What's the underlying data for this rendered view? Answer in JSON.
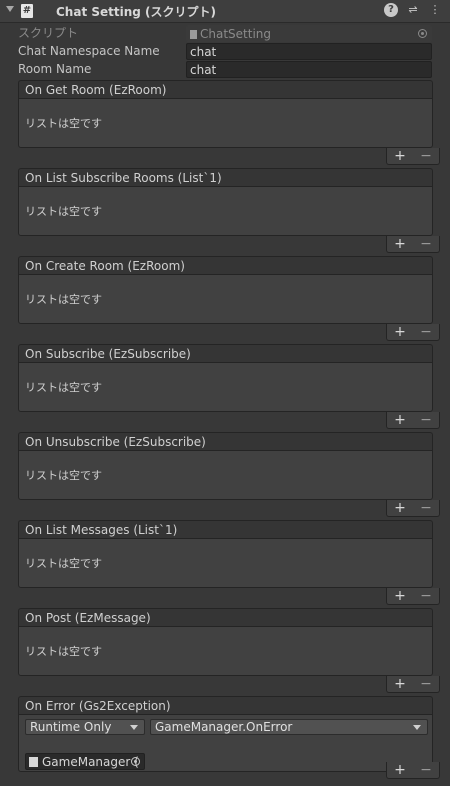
{
  "header": {
    "title": "Chat Setting (スクリプト)",
    "icon": "#"
  },
  "script_row": {
    "label": "スクリプト",
    "value": "ChatSetting"
  },
  "fields": [
    {
      "label": "Chat Namespace Name",
      "value": "chat"
    },
    {
      "label": "Room Name",
      "value": "chat"
    }
  ],
  "events": [
    {
      "title": "On Get Room (EzRoom)",
      "empty_text": "リストは空です"
    },
    {
      "title": "On List Subscribe Rooms (List`1)",
      "empty_text": "リストは空です"
    },
    {
      "title": "On Create Room (EzRoom)",
      "empty_text": "リストは空です"
    },
    {
      "title": "On Subscribe (EzSubscribe)",
      "empty_text": "リストは空です"
    },
    {
      "title": "On Unsubscribe (EzSubscribe)",
      "empty_text": "リストは空です"
    },
    {
      "title": "On List Messages (List`1)",
      "empty_text": "リストは空です"
    },
    {
      "title": "On Post (EzMessage)",
      "empty_text": "リストは空です"
    }
  ],
  "error_event": {
    "title": "On Error (Gs2Exception)",
    "runtime_mode": "Runtime Only",
    "function": "GameManager.OnError",
    "target": "GameManager ("
  },
  "list_controls": {
    "add": "+",
    "remove": "−"
  }
}
